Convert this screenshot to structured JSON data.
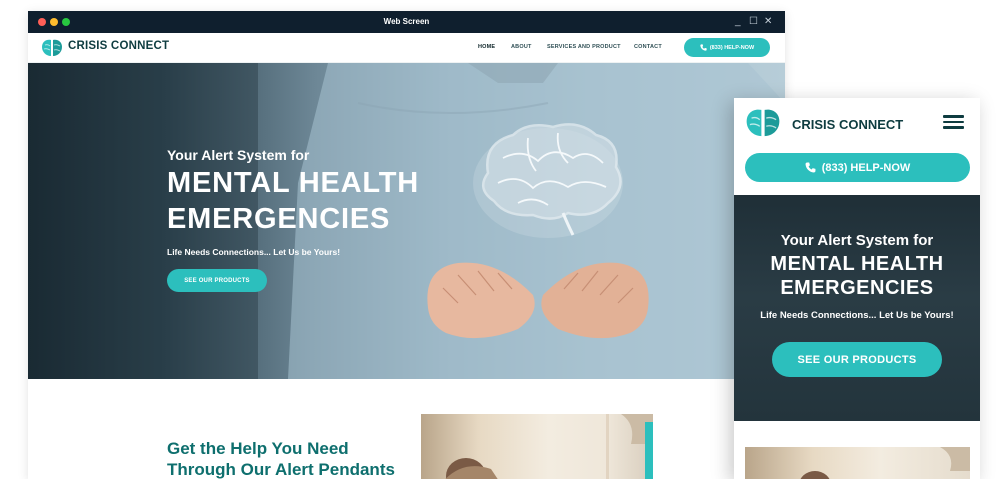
{
  "window": {
    "title": "Web Screen",
    "controls": {
      "minimize": "_",
      "maximize": "☐",
      "close": "✕"
    },
    "traffic_lights": [
      "#ff5f57",
      "#febc2e",
      "#28c840"
    ]
  },
  "brand": {
    "name": "CRISIS CONNECT",
    "logo_icon": "brain-logo-icon",
    "colors": {
      "teal": "#2cbfbd",
      "dark_teal": "#0e6f6e",
      "navy": "#0e3c40"
    }
  },
  "nav": {
    "items": [
      {
        "label": "HOME",
        "active": true
      },
      {
        "label": "ABOUT",
        "active": false
      },
      {
        "label": "SERVICES AND PRODUCT",
        "active": false
      },
      {
        "label": "CONTACT",
        "active": false
      }
    ],
    "phone_label": "(833) HELP-NOW",
    "phone_icon": "phone-icon"
  },
  "hero": {
    "tagline": "Your Alert System for",
    "title_line1": "MENTAL HEALTH",
    "title_line2": "EMERGENCIES",
    "subtitle": "Life Needs Connections... Let Us be Yours!",
    "cta_label": "SEE OUR PRODUCTS"
  },
  "section2": {
    "title_line1": "Get the Help You Need",
    "title_line2": "Through Our Alert Pendants"
  },
  "mobile": {
    "menu_icon": "hamburger-menu-icon",
    "phone_label": "(833) HELP-NOW"
  }
}
